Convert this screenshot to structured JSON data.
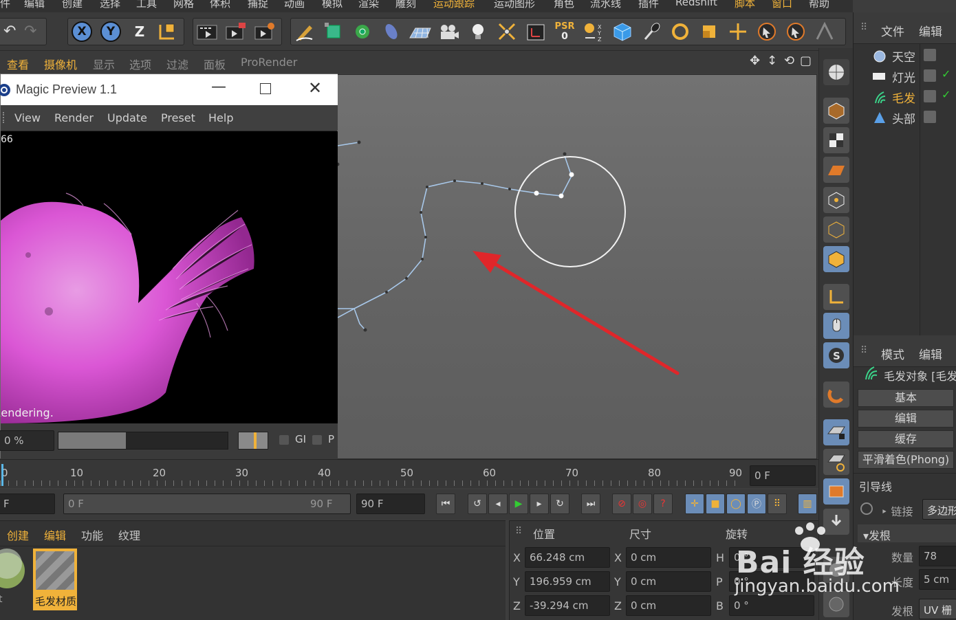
{
  "menubar": {
    "items": [
      "件",
      "编辑",
      "创建",
      "选择",
      "工具",
      "网格",
      "体积",
      "捕捉",
      "动画",
      "模拟",
      "渲染",
      "雕刻",
      "运动跟踪",
      "运动图形",
      "角色",
      "流水线",
      "插件",
      "Redshift",
      "脚本",
      "窗口",
      "帮助"
    ]
  },
  "toolbar": {
    "axis_x": "X",
    "axis_y": "Y",
    "axis_z": "Z",
    "psr_label": "PSR",
    "psr_value": "0"
  },
  "viewport_menu": {
    "items": [
      "查看",
      "摄像机",
      "显示",
      "选项",
      "过滤",
      "面板",
      "ProRender"
    ]
  },
  "magic_preview": {
    "title": "Magic Preview 1.1",
    "menu": [
      "View",
      "Render",
      "Update",
      "Preset",
      "Help"
    ],
    "frame_counter": "66",
    "status": "Rendering.",
    "progress_percent": "0 %",
    "progress_value": 0.4,
    "gi_label": "GI",
    "p_label": "P"
  },
  "object_manager": {
    "tab_file": "文件",
    "tab_edit": "编辑",
    "objects": [
      {
        "name": "天空",
        "icon": "sky-icon",
        "selected": false
      },
      {
        "name": "灯光",
        "icon": "light-icon",
        "selected": false
      },
      {
        "name": "毛发",
        "icon": "hair-icon",
        "selected": true
      },
      {
        "name": "头部",
        "icon": "polygon-icon",
        "selected": false
      }
    ]
  },
  "attribute_manager": {
    "tab_mode": "模式",
    "tab_edit": "编辑",
    "object_title": "毛发对象 [毛发",
    "tabs": [
      "基本",
      "编辑",
      "缓存",
      "平滑着色(Phong)"
    ],
    "section_guides": "引导线",
    "link_label": "链接",
    "link_value": "多边形",
    "section_roots": "▾发根",
    "count_label": "数量",
    "count_value": "78",
    "length_label": "长度",
    "length_value": "5 cm",
    "root_label": "发根",
    "root_value": "UV 栅"
  },
  "timeline": {
    "ticks": [
      "0",
      "10",
      "20",
      "30",
      "40",
      "50",
      "60",
      "70",
      "80",
      "90"
    ],
    "current_frame": "0 F"
  },
  "transport": {
    "start_field": "F",
    "range_start": "0 F",
    "range_end": "90 F",
    "end_field": "90 F"
  },
  "material_manager": {
    "menu": [
      "创建",
      "编辑",
      "功能",
      "纹理"
    ],
    "materials": [
      {
        "name": "t"
      },
      {
        "name": "毛发材质"
      }
    ]
  },
  "coordinates": {
    "headers": [
      "位置",
      "尺寸",
      "旋转"
    ],
    "rows": [
      {
        "axis": "X",
        "pos": "66.248 cm",
        "size_axis": "X",
        "size": "0 cm",
        "rot_axis": "H",
        "rot": "0 °"
      },
      {
        "axis": "Y",
        "pos": "196.959 cm",
        "size_axis": "Y",
        "size": "0 cm",
        "rot_axis": "P",
        "rot": "0 °"
      },
      {
        "axis": "Z",
        "pos": "-39.294 cm",
        "size_axis": "Z",
        "size": "0 cm",
        "rot_axis": "B",
        "rot": "0 °"
      }
    ]
  },
  "watermark": {
    "brand": "Bai 经验",
    "url": "jingyan.baidu.com"
  },
  "colors": {
    "accent_orange": "#f0b23a",
    "spline_blue": "#a8c8ea",
    "arrow_red": "#e0262a",
    "fur_pink": "#e65be0"
  }
}
